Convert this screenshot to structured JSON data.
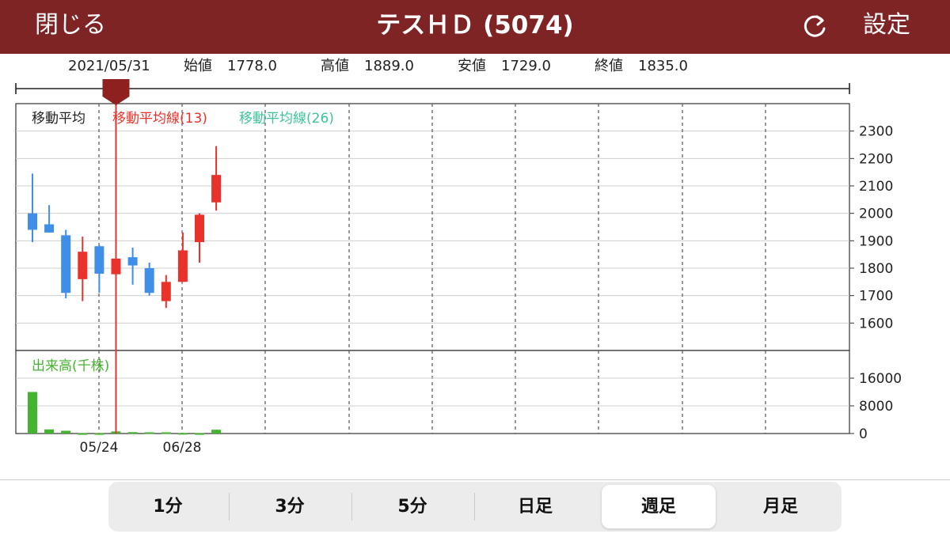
{
  "header": {
    "close_label": "閉じる",
    "title": "テスＨＤ (5074)",
    "settings_label": "設定",
    "background": "#7f2424"
  },
  "info": {
    "date": "2021/05/31",
    "open_label": "始値",
    "open_value": "1778.0",
    "high_label": "高値",
    "high_value": "1889.0",
    "low_label": "安値",
    "low_value": "1729.0",
    "close_label": "終値",
    "close_value": "1835.0"
  },
  "legend": {
    "ma_label": "移動平均",
    "ma13_label": "移動平均線(13)",
    "ma26_label": "移動平均線(26)",
    "volume_label": "出来高(千株)"
  },
  "colors": {
    "up": "#e8322b",
    "down": "#3f8ee8",
    "volume": "#44b32f",
    "cursor": "#e8322b",
    "ma13": "#e8322b",
    "ma26": "#3cc39a",
    "volume_label": "#44b32f"
  },
  "chart_data": {
    "type": "candlestick",
    "price_ticks": [
      1600,
      1700,
      1800,
      1900,
      2000,
      2100,
      2200,
      2300
    ],
    "price_range": [
      1500,
      2400
    ],
    "volume_ticks": [
      0,
      8000,
      16000
    ],
    "volume_range": [
      0,
      24000
    ],
    "x_labels": [
      "05/24",
      "06/28"
    ],
    "cursor_index": 5,
    "candles": [
      {
        "o": 2000,
        "h": 2145,
        "l": 1895,
        "c": 1940
      },
      {
        "o": 1960,
        "h": 2030,
        "l": 1930,
        "c": 1930
      },
      {
        "o": 1920,
        "h": 1940,
        "l": 1690,
        "c": 1710
      },
      {
        "o": 1760,
        "h": 1915,
        "l": 1680,
        "c": 1860
      },
      {
        "o": 1880,
        "h": 1885,
        "l": 1710,
        "c": 1780
      },
      {
        "o": 1778,
        "h": 1889,
        "l": 1729,
        "c": 1835
      },
      {
        "o": 1840,
        "h": 1875,
        "l": 1740,
        "c": 1810
      },
      {
        "o": 1800,
        "h": 1820,
        "l": 1700,
        "c": 1710
      },
      {
        "o": 1680,
        "h": 1775,
        "l": 1655,
        "c": 1750
      },
      {
        "o": 1750,
        "h": 1930,
        "l": 1750,
        "c": 1865
      },
      {
        "o": 1895,
        "h": 2000,
        "l": 1820,
        "c": 1995
      },
      {
        "o": 2040,
        "h": 2245,
        "l": 2010,
        "c": 2140
      }
    ],
    "volumes": [
      12000,
      1200,
      800,
      100,
      100,
      600,
      400,
      350,
      350,
      150,
      100,
      1100
    ]
  },
  "tabs": [
    {
      "label": "1分"
    },
    {
      "label": "3分"
    },
    {
      "label": "5分"
    },
    {
      "label": "日足"
    },
    {
      "label": "週足",
      "active": true
    },
    {
      "label": "月足"
    }
  ]
}
